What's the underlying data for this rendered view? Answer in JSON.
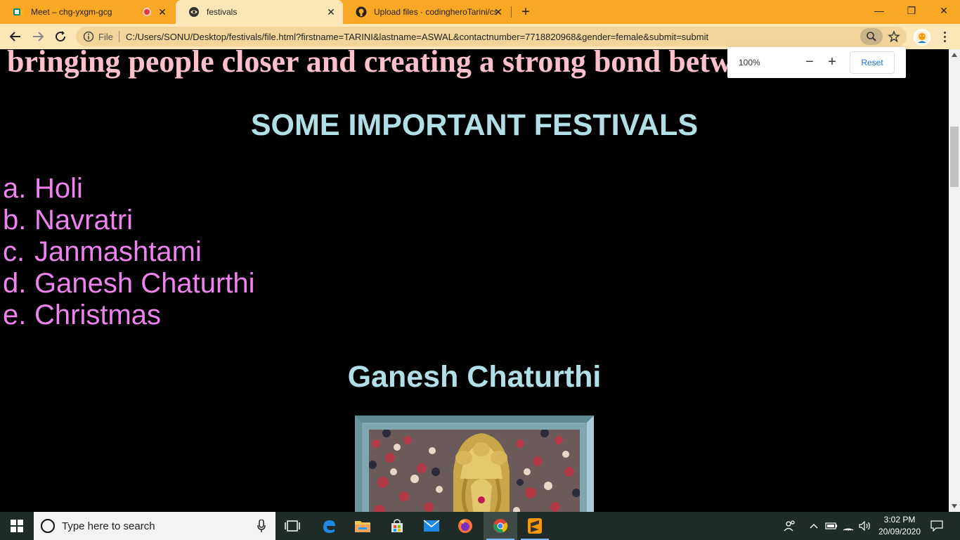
{
  "browser": {
    "tabs": [
      {
        "title": "Meet – chg-yxgm-gcg",
        "icon": "meet-icon",
        "recording": true
      },
      {
        "title": "festivals",
        "icon": "globe-icon",
        "active": true
      },
      {
        "title": "Upload files · codingheroTarini/cs",
        "icon": "github-icon"
      }
    ],
    "scheme": "File",
    "url": "C:/Users/SONU/Desktop/festivals/file.html?firstname=TARINI&lastname=ASWAL&contactnumber=7718820968&gender=female&submit=submit",
    "zoom_popup": {
      "percent": "100%",
      "minus": "−",
      "plus": "+",
      "reset": "Reset"
    }
  },
  "page": {
    "intro_text": "bringing people closer and creating a strong bond between them.",
    "festivals_heading": "SOME IMPORTANT FESTIVALS",
    "festivals": [
      {
        "marker": "a.",
        "name": "Holi"
      },
      {
        "marker": "b.",
        "name": "Navratri"
      },
      {
        "marker": "c.",
        "name": "Janmashtami"
      },
      {
        "marker": "d.",
        "name": "Ganesh Chaturthi"
      },
      {
        "marker": "e.",
        "name": "Christmas"
      }
    ],
    "section_heading": "Ganesh Chaturthi"
  },
  "taskbar": {
    "search_placeholder": "Type here to search",
    "time": "3:02 PM",
    "date": "20/09/2020"
  },
  "colors": {
    "tabbar": "#f9a825",
    "intro_text": "#ffc0cb",
    "heading": "#b0e0e6",
    "list_text": "#ee82ee",
    "page_bg": "#000000"
  }
}
